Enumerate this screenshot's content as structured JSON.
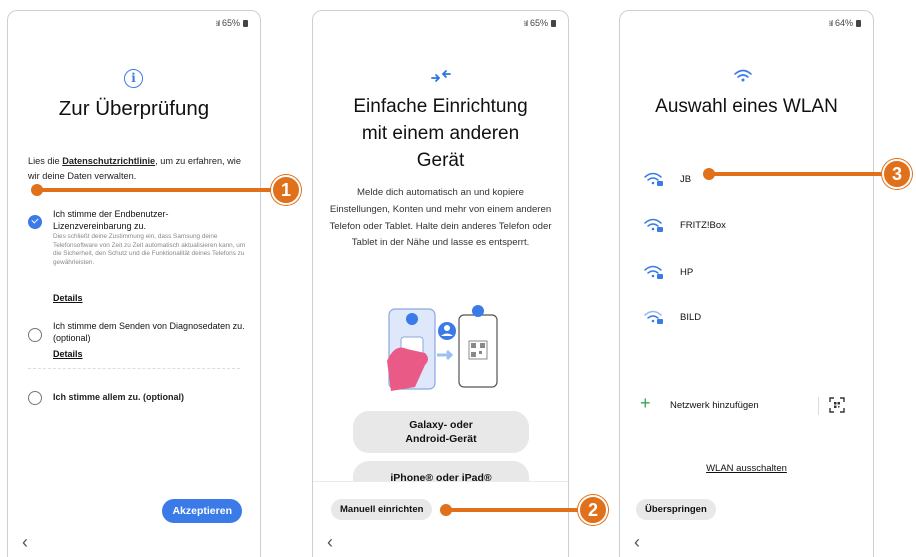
{
  "phone1": {
    "status": {
      "battery": "65%"
    },
    "title": "Zur Überprüfung",
    "intro_pre": "Lies die ",
    "intro_link": "Datenschutzrichtlinie",
    "intro_post": ", um zu erfahren, wie wir deine Daten verwalten.",
    "option1_label": "Ich stimme der Endbenutzer-Lizenzvereinbarung zu.",
    "option1_fine": "Dies schließt deine Zustimmung ein, dass Samsung deine Telefonsoftware von Zeit zu Zeit automatisch aktualisieren kann, um die Sicherheit, den Schutz und die Funktionalität deines Telefons zu gewährleisten.",
    "option1_details": "Details",
    "option2_label": "Ich stimme dem Senden von Diagnosedaten zu. (optional)",
    "option2_details": "Details",
    "option3_label": "Ich stimme allem zu. (optional)",
    "accept_button": "Akzeptieren",
    "back": "‹"
  },
  "phone2": {
    "status": {
      "battery": "65%"
    },
    "title_line1": "Einfache Einrichtung",
    "title_line2": "mit einem anderen",
    "title_line3": "Gerät",
    "description": "Melde dich automatisch an und kopiere Einstellungen, Konten und mehr von einem anderen Telefon oder Tablet. Halte dein anderes Telefon oder Tablet in der Nähe und lasse es entsperrt.",
    "galaxy_button_line1": "Galaxy- oder",
    "galaxy_button_line2": "Android-Gerät",
    "iphone_button": "iPhone® oder iPad®",
    "manual_button": "Manuell einrichten",
    "back": "‹"
  },
  "phone3": {
    "status": {
      "battery": "64%"
    },
    "title": "Auswahl eines WLAN",
    "networks": [
      "JB",
      "FRITZ!Box",
      "HP",
      "BILD"
    ],
    "add_network": "Netzwerk hinzufügen",
    "wlan_off": "WLAN ausschalten",
    "skip_button": "Überspringen",
    "back": "‹"
  },
  "callouts": [
    "1",
    "2",
    "3"
  ],
  "colors": {
    "accent": "#3a7be8",
    "callout": "#e0701a",
    "wifi": "#3a7be8",
    "add": "#2fa84f"
  },
  "icons": [
    "info-icon",
    "link-arrows-icon",
    "wifi-icon",
    "wifi-lock-icon",
    "plus-icon",
    "qr-scan-icon",
    "back-chevron-icon",
    "signal-icon",
    "battery-icon"
  ]
}
